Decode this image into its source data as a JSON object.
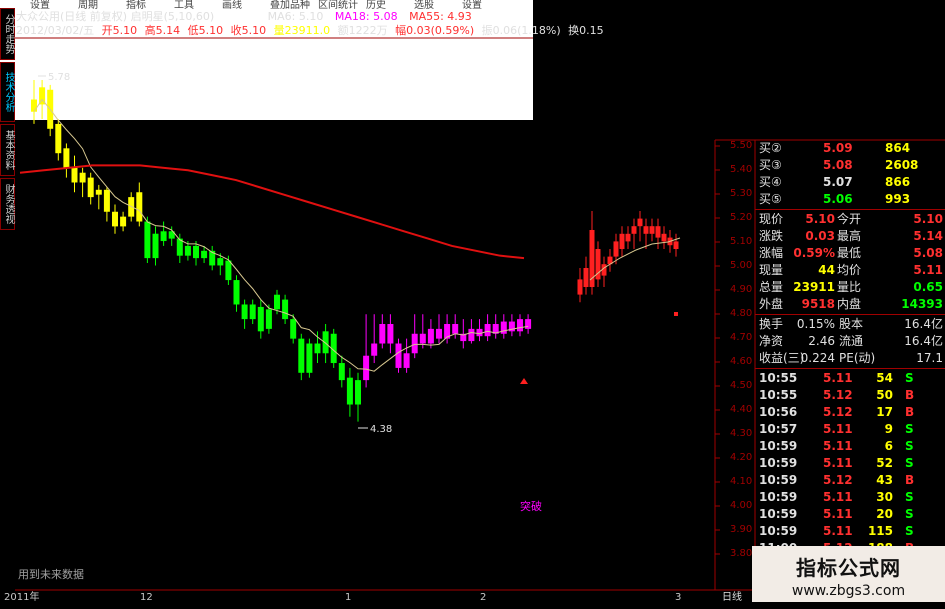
{
  "header": {
    "title": "大众公用(日线 前复权) 启明星(5,10,60)",
    "ma5": "MA6: 5.10",
    "ma18": "MA18: 5.08",
    "ma55": "MA55: 4.93",
    "date": "2012/03/02/五",
    "open": "开5.10",
    "high": "高5.14",
    "low": "低5.10",
    "close": "收5.10",
    "volume": "量23911.0",
    "amount": "额1222万",
    "change": "幅0.03(0.59%)",
    "amplitude": "振0.06(1.18%)",
    "turnover": "换0.15"
  },
  "left_tabs": [
    {
      "label": "分时走势",
      "active": false
    },
    {
      "label": "技术分析",
      "active": true
    },
    {
      "label": "基本资料",
      "active": false
    },
    {
      "label": "财务透视",
      "active": false
    }
  ],
  "top_menu": [
    "设置",
    "周期",
    "指标",
    "工具",
    "画线",
    "叠加品种",
    "区间统计",
    "历史",
    "选股",
    "设置"
  ],
  "annotations": {
    "high_label": "5.78",
    "low_label": "4.38",
    "signal_label": "突破",
    "footnote": "用到未来数据"
  },
  "price_scale": [
    "5.50",
    "5.40",
    "5.30",
    "5.20",
    "5.10",
    "5.00",
    "4.90",
    "4.80",
    "4.70",
    "4.60",
    "4.50",
    "4.40",
    "4.30",
    "4.20",
    "4.10",
    "4.00",
    "3.90",
    "3.80"
  ],
  "order_book": [
    {
      "label": "买②",
      "price": "5.09",
      "vol": "864",
      "price_color": "#ff3030",
      "vol_color": "#ffff00"
    },
    {
      "label": "买③",
      "price": "5.08",
      "vol": "2608",
      "price_color": "#ff3030",
      "vol_color": "#ffff00"
    },
    {
      "label": "买④",
      "price": "5.07",
      "vol": "866",
      "price_color": "#e0e0e0",
      "vol_color": "#ffff00"
    },
    {
      "label": "买⑤",
      "price": "5.06",
      "vol": "993",
      "price_color": "#00ff00",
      "vol_color": "#ffff00"
    }
  ],
  "quote": [
    {
      "label": "现价",
      "value": "5.10",
      "label2": "今开",
      "value2": "5.10",
      "c1": "#ff3030",
      "c2": "#ff3030"
    },
    {
      "label": "涨跌",
      "value": "0.03",
      "label2": "最高",
      "value2": "5.14",
      "c1": "#ff3030",
      "c2": "#ff3030"
    },
    {
      "label": "涨幅",
      "value": "0.59%",
      "label2": "最低",
      "value2": "5.08",
      "c1": "#ff3030",
      "c2": "#ff3030"
    },
    {
      "label": "现量",
      "value": "44",
      "label2": "均价",
      "value2": "5.11",
      "c1": "#ffff00",
      "c2": "#ff3030"
    },
    {
      "label": "总量",
      "value": "23911",
      "label2": "量比",
      "value2": "0.65",
      "c1": "#ffff00",
      "c2": "#00ff00"
    },
    {
      "label": "外盘",
      "value": "9518",
      "label2": "内盘",
      "value2": "14393",
      "c1": "#ff3030",
      "c2": "#00ff00"
    }
  ],
  "fundamentals": [
    {
      "label": "换手",
      "value": "0.15%",
      "label2": "股本",
      "value2": "16.4亿"
    },
    {
      "label": "净资",
      "value": "2.46",
      "label2": "流通",
      "value2": "16.4亿"
    },
    {
      "label": "收益(三)",
      "value": "0.224",
      "label2": "PE(动)",
      "value2": "17.1"
    }
  ],
  "ticks": [
    {
      "time": "10:55",
      "price": "5.11",
      "vol": "54",
      "side": "S"
    },
    {
      "time": "10:55",
      "price": "5.12",
      "vol": "50",
      "side": "B"
    },
    {
      "time": "10:56",
      "price": "5.12",
      "vol": "17",
      "side": "B"
    },
    {
      "time": "10:57",
      "price": "5.11",
      "vol": "9",
      "side": "S"
    },
    {
      "time": "10:59",
      "price": "5.11",
      "vol": "6",
      "side": "S"
    },
    {
      "time": "10:59",
      "price": "5.11",
      "vol": "52",
      "side": "S"
    },
    {
      "time": "10:59",
      "price": "5.12",
      "vol": "43",
      "side": "B"
    },
    {
      "time": "10:59",
      "price": "5.11",
      "vol": "30",
      "side": "S"
    },
    {
      "time": "10:59",
      "price": "5.11",
      "vol": "20",
      "side": "S"
    },
    {
      "time": "10:59",
      "price": "5.11",
      "vol": "115",
      "side": "S"
    },
    {
      "time": "11:00",
      "price": "5.12",
      "vol": "188",
      "side": "B"
    }
  ],
  "colors": {
    "up": "#ff2020",
    "down": "#00ff00",
    "yellow": "#ffff00",
    "magenta": "#ff00ff",
    "border": "#a00000",
    "ma_long": "#e01010",
    "ma_short": "#d8c890"
  },
  "axis": {
    "dates": [
      "2011年",
      "12",
      "1",
      "2",
      "3"
    ],
    "period": "日线"
  },
  "watermark": {
    "line1": "指标公式网",
    "line2": "www.zbgs3.com"
  },
  "chart_data": {
    "type": "candlestick",
    "candles": [
      {
        "open": 5.7,
        "close": 5.65,
        "high": 5.78,
        "low": 5.6,
        "color": "yellow"
      },
      {
        "open": 5.68,
        "close": 5.75,
        "high": 5.78,
        "low": 5.62,
        "color": "yellow"
      },
      {
        "open": 5.74,
        "close": 5.58,
        "high": 5.76,
        "low": 5.55,
        "color": "yellow"
      },
      {
        "open": 5.6,
        "close": 5.48,
        "high": 5.62,
        "low": 5.45,
        "color": "yellow"
      },
      {
        "open": 5.5,
        "close": 5.42,
        "high": 5.52,
        "low": 5.38,
        "color": "yellow"
      },
      {
        "open": 5.42,
        "close": 5.36,
        "high": 5.47,
        "low": 5.32,
        "color": "yellow"
      },
      {
        "open": 5.36,
        "close": 5.4,
        "high": 5.42,
        "low": 5.3,
        "color": "yellow"
      },
      {
        "open": 5.38,
        "close": 5.3,
        "high": 5.4,
        "low": 5.27,
        "color": "yellow"
      },
      {
        "open": 5.31,
        "close": 5.33,
        "high": 5.35,
        "low": 5.25,
        "color": "yellow"
      },
      {
        "open": 5.33,
        "close": 5.24,
        "high": 5.34,
        "low": 5.2,
        "color": "yellow"
      },
      {
        "open": 5.24,
        "close": 5.18,
        "high": 5.27,
        "low": 5.15,
        "color": "yellow"
      },
      {
        "open": 5.18,
        "close": 5.22,
        "high": 5.24,
        "low": 5.16,
        "color": "yellow"
      },
      {
        "open": 5.22,
        "close": 5.3,
        "high": 5.32,
        "low": 5.2,
        "color": "yellow"
      },
      {
        "open": 5.32,
        "close": 5.2,
        "high": 5.36,
        "low": 5.18,
        "color": "yellow"
      },
      {
        "open": 5.2,
        "close": 5.05,
        "high": 5.22,
        "low": 5.03,
        "color": "green"
      },
      {
        "open": 5.05,
        "close": 5.15,
        "high": 5.18,
        "low": 5.02,
        "color": "green"
      },
      {
        "open": 5.12,
        "close": 5.16,
        "high": 5.2,
        "low": 5.1,
        "color": "green"
      },
      {
        "open": 5.16,
        "close": 5.13,
        "high": 5.18,
        "low": 5.1,
        "color": "green"
      },
      {
        "open": 5.13,
        "close": 5.06,
        "high": 5.15,
        "low": 5.03,
        "color": "green"
      },
      {
        "open": 5.06,
        "close": 5.1,
        "high": 5.12,
        "low": 5.04,
        "color": "green"
      },
      {
        "open": 5.1,
        "close": 5.05,
        "high": 5.12,
        "low": 5.02,
        "color": "green"
      },
      {
        "open": 5.05,
        "close": 5.08,
        "high": 5.1,
        "low": 5.03,
        "color": "green"
      },
      {
        "open": 5.08,
        "close": 5.02,
        "high": 5.1,
        "low": 5.0,
        "color": "green"
      },
      {
        "open": 5.02,
        "close": 5.05,
        "high": 5.07,
        "low": 4.98,
        "color": "green"
      },
      {
        "open": 5.04,
        "close": 4.96,
        "high": 5.06,
        "low": 4.94,
        "color": "green"
      },
      {
        "open": 4.96,
        "close": 4.86,
        "high": 4.98,
        "low": 4.83,
        "color": "green"
      },
      {
        "open": 4.86,
        "close": 4.8,
        "high": 4.88,
        "low": 4.76,
        "color": "green"
      },
      {
        "open": 4.8,
        "close": 4.86,
        "high": 4.88,
        "low": 4.78,
        "color": "green"
      },
      {
        "open": 4.85,
        "close": 4.75,
        "high": 4.88,
        "low": 4.72,
        "color": "green"
      },
      {
        "open": 4.76,
        "close": 4.84,
        "high": 4.86,
        "low": 4.74,
        "color": "green"
      },
      {
        "open": 4.84,
        "close": 4.9,
        "high": 4.92,
        "low": 4.82,
        "color": "green"
      },
      {
        "open": 4.88,
        "close": 4.8,
        "high": 4.9,
        "low": 4.78,
        "color": "green"
      },
      {
        "open": 4.8,
        "close": 4.72,
        "high": 4.82,
        "low": 4.7,
        "color": "green"
      },
      {
        "open": 4.72,
        "close": 4.58,
        "high": 4.74,
        "low": 4.55,
        "color": "green"
      },
      {
        "open": 4.58,
        "close": 4.7,
        "high": 4.72,
        "low": 4.56,
        "color": "green"
      },
      {
        "open": 4.7,
        "close": 4.66,
        "high": 4.75,
        "low": 4.62,
        "color": "green"
      },
      {
        "open": 4.66,
        "close": 4.75,
        "high": 4.78,
        "low": 4.62,
        "color": "green"
      },
      {
        "open": 4.74,
        "close": 4.62,
        "high": 4.76,
        "low": 4.6,
        "color": "green"
      },
      {
        "open": 4.62,
        "close": 4.55,
        "high": 4.65,
        "low": 4.52,
        "color": "green"
      },
      {
        "open": 4.56,
        "close": 4.45,
        "high": 4.6,
        "low": 4.4,
        "color": "green"
      },
      {
        "open": 4.45,
        "close": 4.55,
        "high": 4.58,
        "low": 4.38,
        "color": "green"
      },
      {
        "open": 4.55,
        "close": 4.65,
        "high": 4.82,
        "low": 4.52,
        "color": "magenta"
      },
      {
        "open": 4.65,
        "close": 4.7,
        "high": 4.82,
        "low": 4.62,
        "color": "magenta"
      },
      {
        "open": 4.7,
        "close": 4.78,
        "high": 4.82,
        "low": 4.68,
        "color": "magenta"
      },
      {
        "open": 4.78,
        "close": 4.7,
        "high": 4.82,
        "low": 4.66,
        "color": "magenta"
      },
      {
        "open": 4.7,
        "close": 4.6,
        "high": 4.72,
        "low": 4.58,
        "color": "magenta"
      },
      {
        "open": 4.6,
        "close": 4.66,
        "high": 4.72,
        "low": 4.58,
        "color": "magenta"
      },
      {
        "open": 4.66,
        "close": 4.74,
        "high": 4.82,
        "low": 4.64,
        "color": "magenta"
      },
      {
        "open": 4.74,
        "close": 4.7,
        "high": 4.82,
        "low": 4.68,
        "color": "magenta"
      },
      {
        "open": 4.7,
        "close": 4.76,
        "high": 4.8,
        "low": 4.68,
        "color": "magenta"
      },
      {
        "open": 4.76,
        "close": 4.72,
        "high": 4.82,
        "low": 4.7,
        "color": "magenta"
      },
      {
        "open": 4.72,
        "close": 4.78,
        "high": 4.82,
        "low": 4.7,
        "color": "magenta"
      },
      {
        "open": 4.78,
        "close": 4.74,
        "high": 4.82,
        "low": 4.72,
        "color": "magenta"
      },
      {
        "open": 4.74,
        "close": 4.71,
        "high": 4.8,
        "low": 4.68,
        "color": "magenta"
      },
      {
        "open": 4.71,
        "close": 4.76,
        "high": 4.8,
        "low": 4.7,
        "color": "magenta"
      },
      {
        "open": 4.76,
        "close": 4.73,
        "high": 4.8,
        "low": 4.71,
        "color": "magenta"
      },
      {
        "open": 4.73,
        "close": 4.78,
        "high": 4.82,
        "low": 4.71,
        "color": "magenta"
      },
      {
        "open": 4.78,
        "close": 4.74,
        "high": 4.82,
        "low": 4.72,
        "color": "magenta"
      },
      {
        "open": 4.74,
        "close": 4.79,
        "high": 4.82,
        "low": 4.72,
        "color": "magenta"
      },
      {
        "open": 4.79,
        "close": 4.75,
        "high": 4.82,
        "low": 4.73,
        "color": "magenta"
      },
      {
        "open": 4.75,
        "close": 4.8,
        "high": 4.82,
        "low": 4.73,
        "color": "magenta"
      },
      {
        "open": 4.8,
        "close": 4.76,
        "high": 4.82,
        "low": 4.74,
        "color": "magenta"
      }
    ],
    "ma_long": [
      5.4,
      5.41,
      5.42,
      5.43,
      5.43,
      5.43,
      5.42,
      5.41,
      5.39,
      5.37,
      5.34,
      5.31,
      5.28,
      5.25,
      5.22,
      5.19,
      5.16,
      5.13,
      5.1,
      5.08,
      5.06,
      5.05
    ],
    "ma_short_note": "yellow moving average follows candles"
  }
}
